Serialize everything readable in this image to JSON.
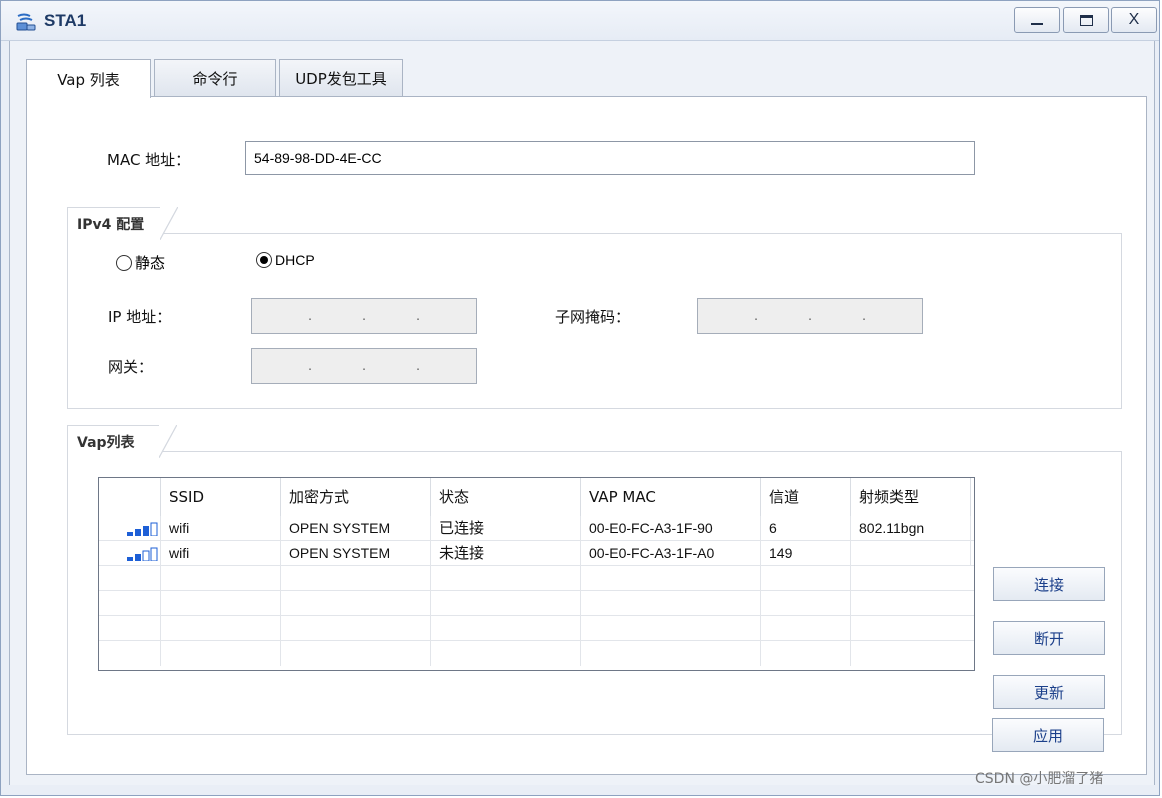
{
  "window": {
    "title": "STA1",
    "minimize_glyph": "",
    "maximize_glyph": "",
    "close_label": "X"
  },
  "tabs": [
    {
      "label": "Vap 列表",
      "active": true
    },
    {
      "label": "命令行",
      "active": false
    },
    {
      "label": "UDP发包工具",
      "active": false
    }
  ],
  "mac": {
    "label": "MAC 地址：",
    "value": "54-89-98-DD-4E-CC"
  },
  "ipv4": {
    "group_title": "IPv4 配置",
    "static_label": "静态",
    "dhcp_label": "DHCP",
    "selected": "DHCP",
    "ip_label": "IP 地址：",
    "mask_label": "子网掩码：",
    "gateway_label": "网关：",
    "ip_dot": "."
  },
  "vap": {
    "group_title": "Vap列表",
    "columns": [
      "SSID",
      "加密方式",
      "状态",
      "VAP MAC",
      "信道",
      "射频类型"
    ],
    "rows": [
      {
        "signal": 3,
        "ssid": "wifi",
        "encryption": "OPEN SYSTEM",
        "status": "已连接",
        "vap_mac": "00-E0-FC-A3-1F-90",
        "channel": "6",
        "radio_type": "802.11bgn"
      },
      {
        "signal": 2,
        "ssid": "wifi",
        "encryption": "OPEN SYSTEM",
        "status": "未连接",
        "vap_mac": "00-E0-FC-A3-1F-A0",
        "channel": "149",
        "radio_type": ""
      }
    ]
  },
  "buttons": {
    "connect": "连接",
    "disconnect": "断开",
    "refresh": "更新",
    "apply": "应用"
  },
  "watermark": "CSDN @小肥溜了猪",
  "colors": {
    "accent_text": "#1b3f8a",
    "signal_blue": "#1d5fd6"
  },
  "icons": {
    "app": "network-station-icon",
    "signal": "signal-strength-icon"
  }
}
